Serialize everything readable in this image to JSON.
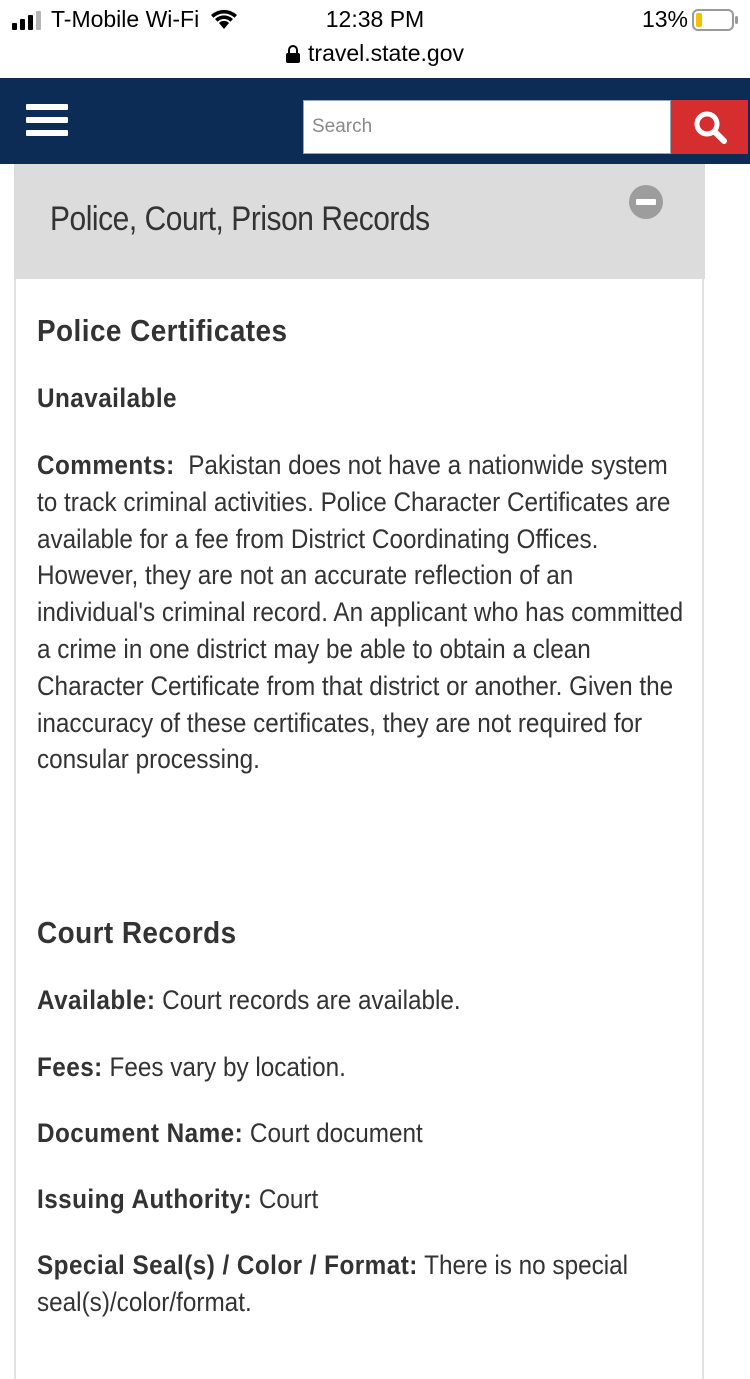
{
  "status_bar": {
    "carrier": "T-Mobile Wi-Fi",
    "time": "12:38 PM",
    "url": "travel.state.gov",
    "battery": "13%"
  },
  "header": {
    "search_placeholder": "Search"
  },
  "accordion": {
    "title": "Police, Court, Prison Records"
  },
  "police": {
    "heading": "Police Certificates",
    "status": "Unavailable",
    "comments_label": "Comments:",
    "comments_text": "Pakistan does not have a nationwide system to track criminal activities.  Police Character Certificates are available for a fee from District Coordinating Offices.  However, they are not an accurate reflection of an individual's criminal record.  An applicant who has committed a crime in one district may be able to obtain a clean Character Certificate from that district or another.  Given the inaccuracy of these certificates, they are not required for consular processing."
  },
  "court": {
    "heading": "Court Records",
    "fields": [
      {
        "label": "Available:",
        "value": "Court records are available."
      },
      {
        "label": "Fees:",
        "value": "Fees vary by location."
      },
      {
        "label": "Document Name:",
        "value": "Court document"
      },
      {
        "label": "Issuing Authority:",
        "value": "Court"
      },
      {
        "label": "Special Seal(s) / Color / Format:",
        "value": "There is no special seal(s)/color/format."
      }
    ]
  },
  "colors": {
    "header_bg": "#0c2b55",
    "search_button": "#d62e2e",
    "accordion_header_bg": "#dcdcdc",
    "battery_level": "#f2c200"
  }
}
